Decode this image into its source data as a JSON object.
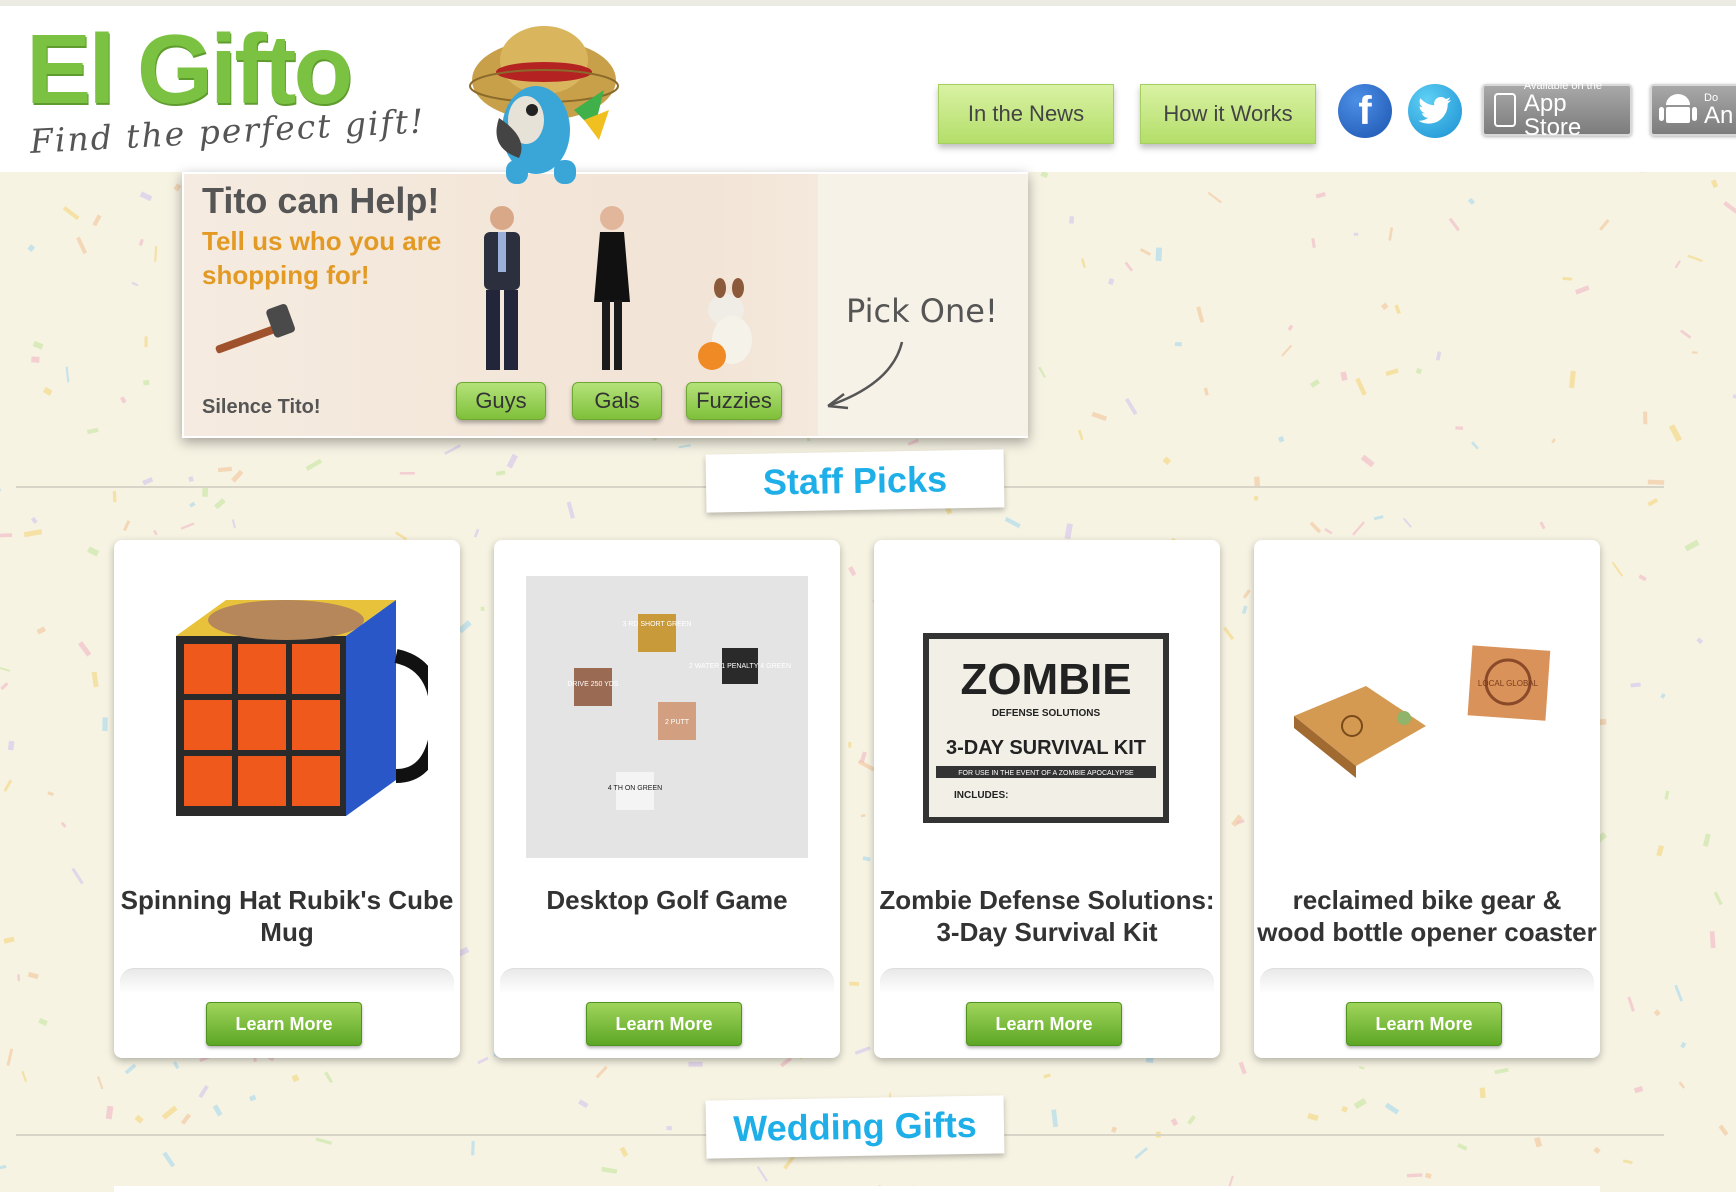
{
  "brand": {
    "name": "El Gifto",
    "tagline": "Find the perfect gift!",
    "accent": "#7cc242",
    "heading_color": "#1eaee8"
  },
  "nav": {
    "news": "In the News",
    "how": "How it Works",
    "facebook_icon": "f",
    "appstore_small": "Available on the",
    "appstore_big": "App Store",
    "android_small": "Do",
    "android_big": "An"
  },
  "tito": {
    "title": "Tito can Help!",
    "subtitle": "Tell us who you are shopping for!",
    "silence": "Silence Tito!",
    "options": [
      "Guys",
      "Gals",
      "Fuzzies"
    ],
    "pick_one": "Pick One!"
  },
  "sections": {
    "staff_picks": "Staff Picks",
    "wedding": "Wedding Gifts"
  },
  "products": [
    {
      "title": "Spinning Hat Rubik's Cube Mug",
      "button": "Learn More"
    },
    {
      "title": "Desktop Golf Game",
      "button": "Learn More"
    },
    {
      "title": "Zombie Defense Solutions: 3-Day Survival Kit",
      "button": "Learn More"
    },
    {
      "title": "reclaimed bike gear & wood bottle opener coaster",
      "button": "Learn More"
    }
  ],
  "product_images": {
    "dice": [
      "3 RD SHORT GREEN",
      "DRIVE 250 YDS",
      "2 WATER 1 PENALTY 4 GREEN",
      "2 PUTT",
      "4 TH ON GREEN"
    ],
    "zombie_main": "ZOMBIE",
    "zombie_sub": "DEFENSE SOLUTIONS",
    "zombie_kit": "3-DAY SURVIVAL KIT",
    "zombie_note": "FOR USE IN THE EVENT OF A ZOMBIE APOCALYPSE",
    "zombie_includes": "INCLUDES:",
    "coaster_stamp": "LOCAL GLOBAL"
  }
}
